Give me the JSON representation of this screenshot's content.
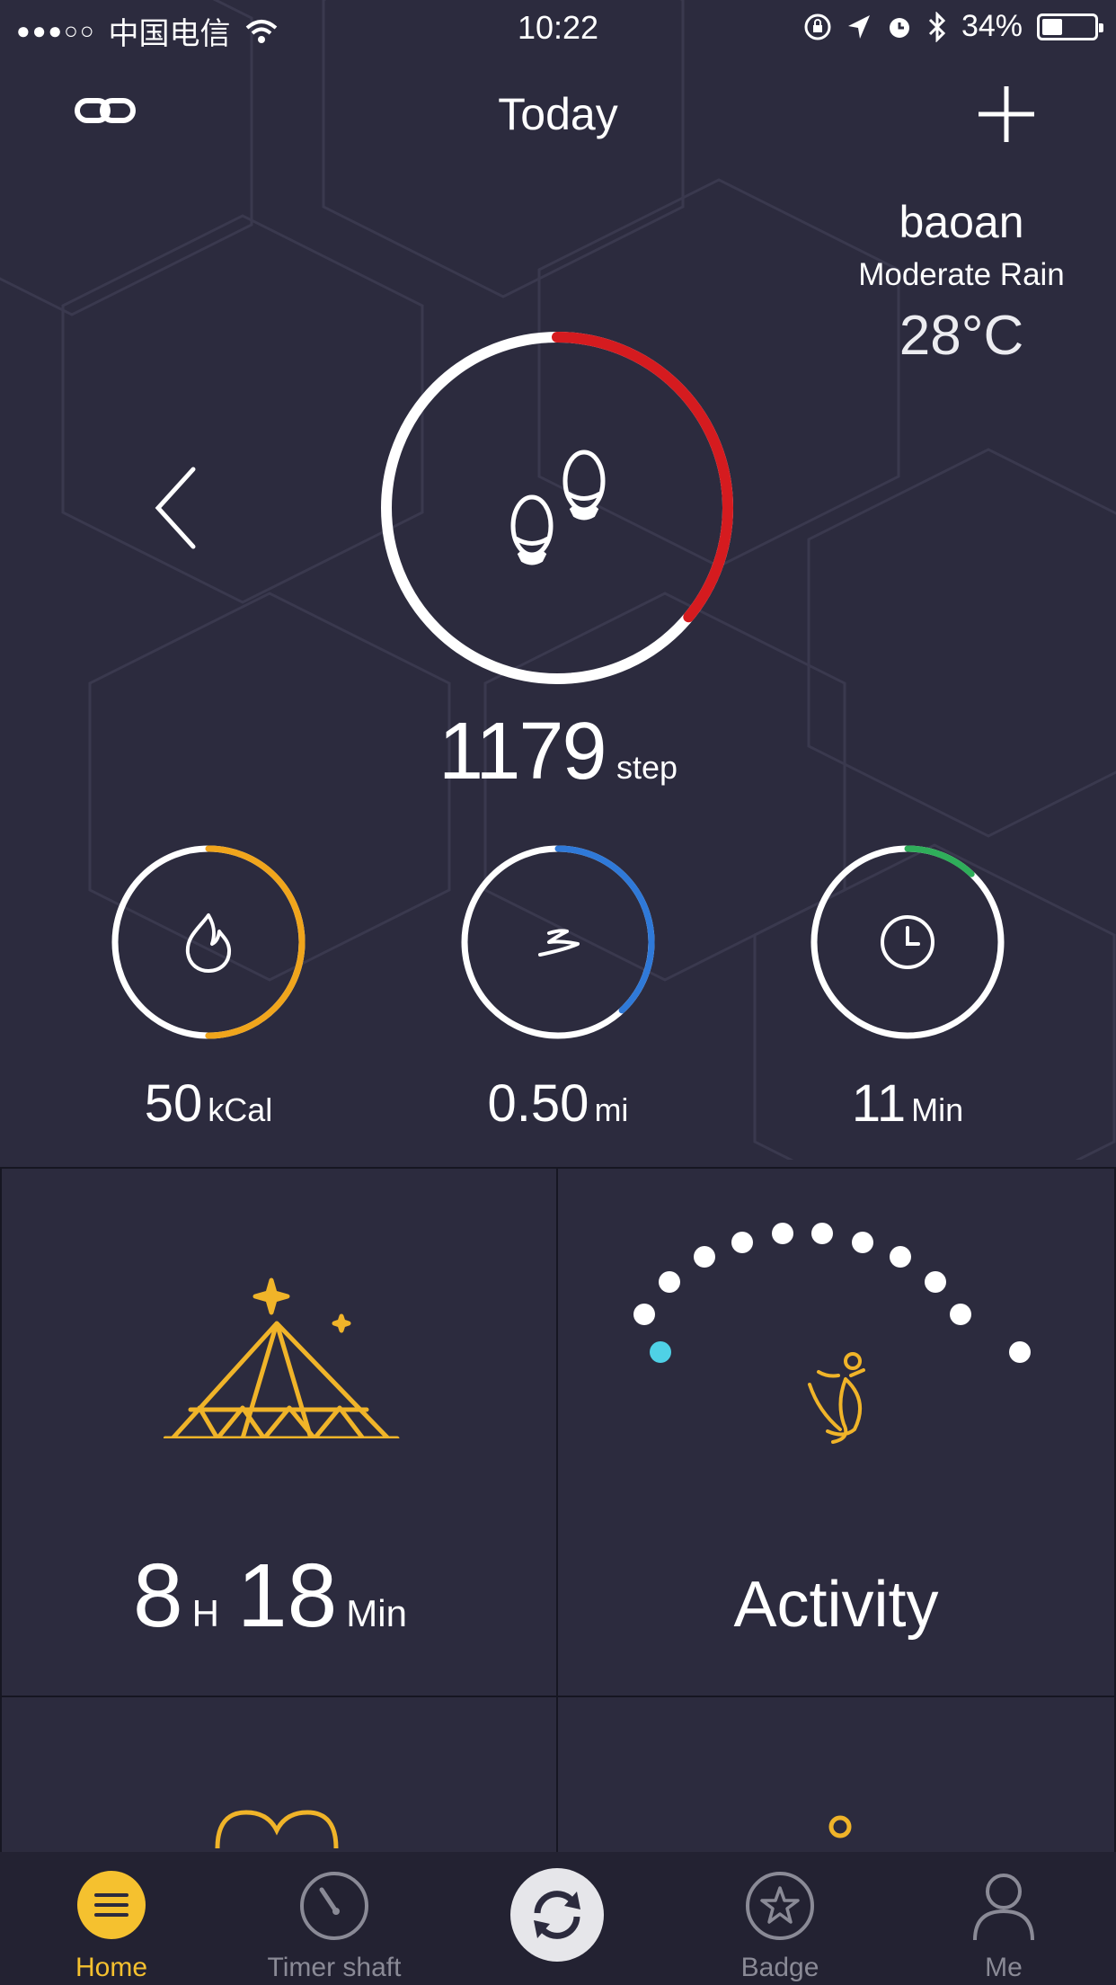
{
  "status_bar": {
    "signal": "●●●○○",
    "carrier": "中国电信",
    "time": "10:22",
    "battery": "34%"
  },
  "header": {
    "title": "Today"
  },
  "weather": {
    "city": "baoan",
    "condition": "Moderate Rain",
    "temperature": "28°C"
  },
  "steps": {
    "value": "1179",
    "unit": "step",
    "progress": 0.36,
    "ring_color": "#d51b1f"
  },
  "metrics": [
    {
      "value": "50",
      "unit": "kCal",
      "icon": "flame-icon",
      "progress": 0.5,
      "color": "#f0a51c"
    },
    {
      "value": "0.50",
      "unit": "mi",
      "icon": "distance-icon",
      "progress": 0.38,
      "color": "#2f79d8"
    },
    {
      "value": "11",
      "unit": "Min",
      "icon": "clock-icon",
      "progress": 0.12,
      "color": "#2fae5a"
    }
  ],
  "sleep": {
    "hours": "8",
    "hours_unit": "H",
    "minutes": "18",
    "minutes_unit": "Min"
  },
  "activity": {
    "label": "Activity"
  },
  "tabs": [
    {
      "label": "Home",
      "icon": "menu-icon",
      "active": true
    },
    {
      "label": "Timer shaft",
      "icon": "timer-icon",
      "active": false
    },
    {
      "label": "",
      "icon": "sync-icon",
      "active": false
    },
    {
      "label": "Badge",
      "icon": "badge-icon",
      "active": false
    },
    {
      "label": "Me",
      "icon": "profile-icon",
      "active": false
    }
  ],
  "colors": {
    "background": "#2c2b3e",
    "accent": "#f5c12f",
    "activity_dot": "#4fd1e6"
  }
}
